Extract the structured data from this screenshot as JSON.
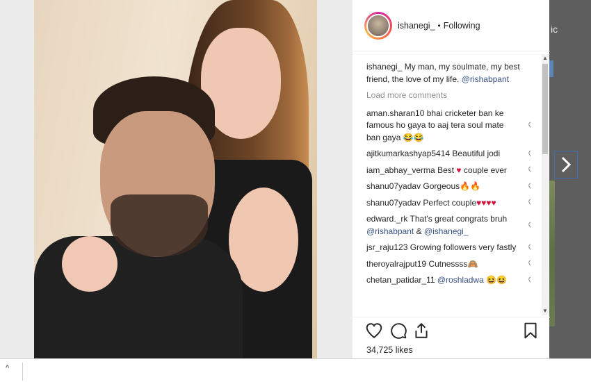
{
  "post": {
    "username": "ishanegi_",
    "separator": "•",
    "follow_status": "Following",
    "likes": "34,725 likes"
  },
  "caption": {
    "user": "ishanegi_",
    "text": "My man, my soulmate, my best friend, the love of my life.",
    "mention": "@rishabpant"
  },
  "load_more": "Load more comments",
  "comments": [
    {
      "user": "aman.sharan10",
      "text": "bhai cricketer ban ke famous ho gaya to aaj tera soul mate ban gaya",
      "emoji": "😂😂"
    },
    {
      "user": "ajitkumarkashyap5414",
      "text": "Beautiful jodi",
      "emoji": ""
    },
    {
      "user": "iam_abhay_verma",
      "text": "Best",
      "emoji": "♥",
      "text2": "couple ever"
    },
    {
      "user": "shanu07yadav",
      "text": "Gorgeous",
      "emoji": "🔥🔥"
    },
    {
      "user": "shanu07yadav",
      "text": "Perfect couple",
      "emoji": "♥♥♥♥"
    },
    {
      "user": "edward._rk",
      "text": "That's great congrats bruh",
      "mention1": "@rishabpant",
      "amp": "&",
      "mention2": "@ishanegi_"
    },
    {
      "user": "jsr_raju123",
      "text": "Growing followers very fastly",
      "emoji": ""
    },
    {
      "user": "theroyalrajput19",
      "text": "Cutnessss",
      "emoji": "🙈"
    },
    {
      "user": "chetan_patidar_11",
      "mention1": "@roshladwa",
      "emoji": "😆😆"
    }
  ],
  "icons": {
    "heart": "heart-icon",
    "comment": "comment-icon",
    "share": "share-icon",
    "bookmark": "bookmark-icon",
    "next": "chevron-right-icon"
  },
  "colors": {
    "mention": "#385185",
    "muted": "#8e8e8e",
    "text": "#262626"
  }
}
